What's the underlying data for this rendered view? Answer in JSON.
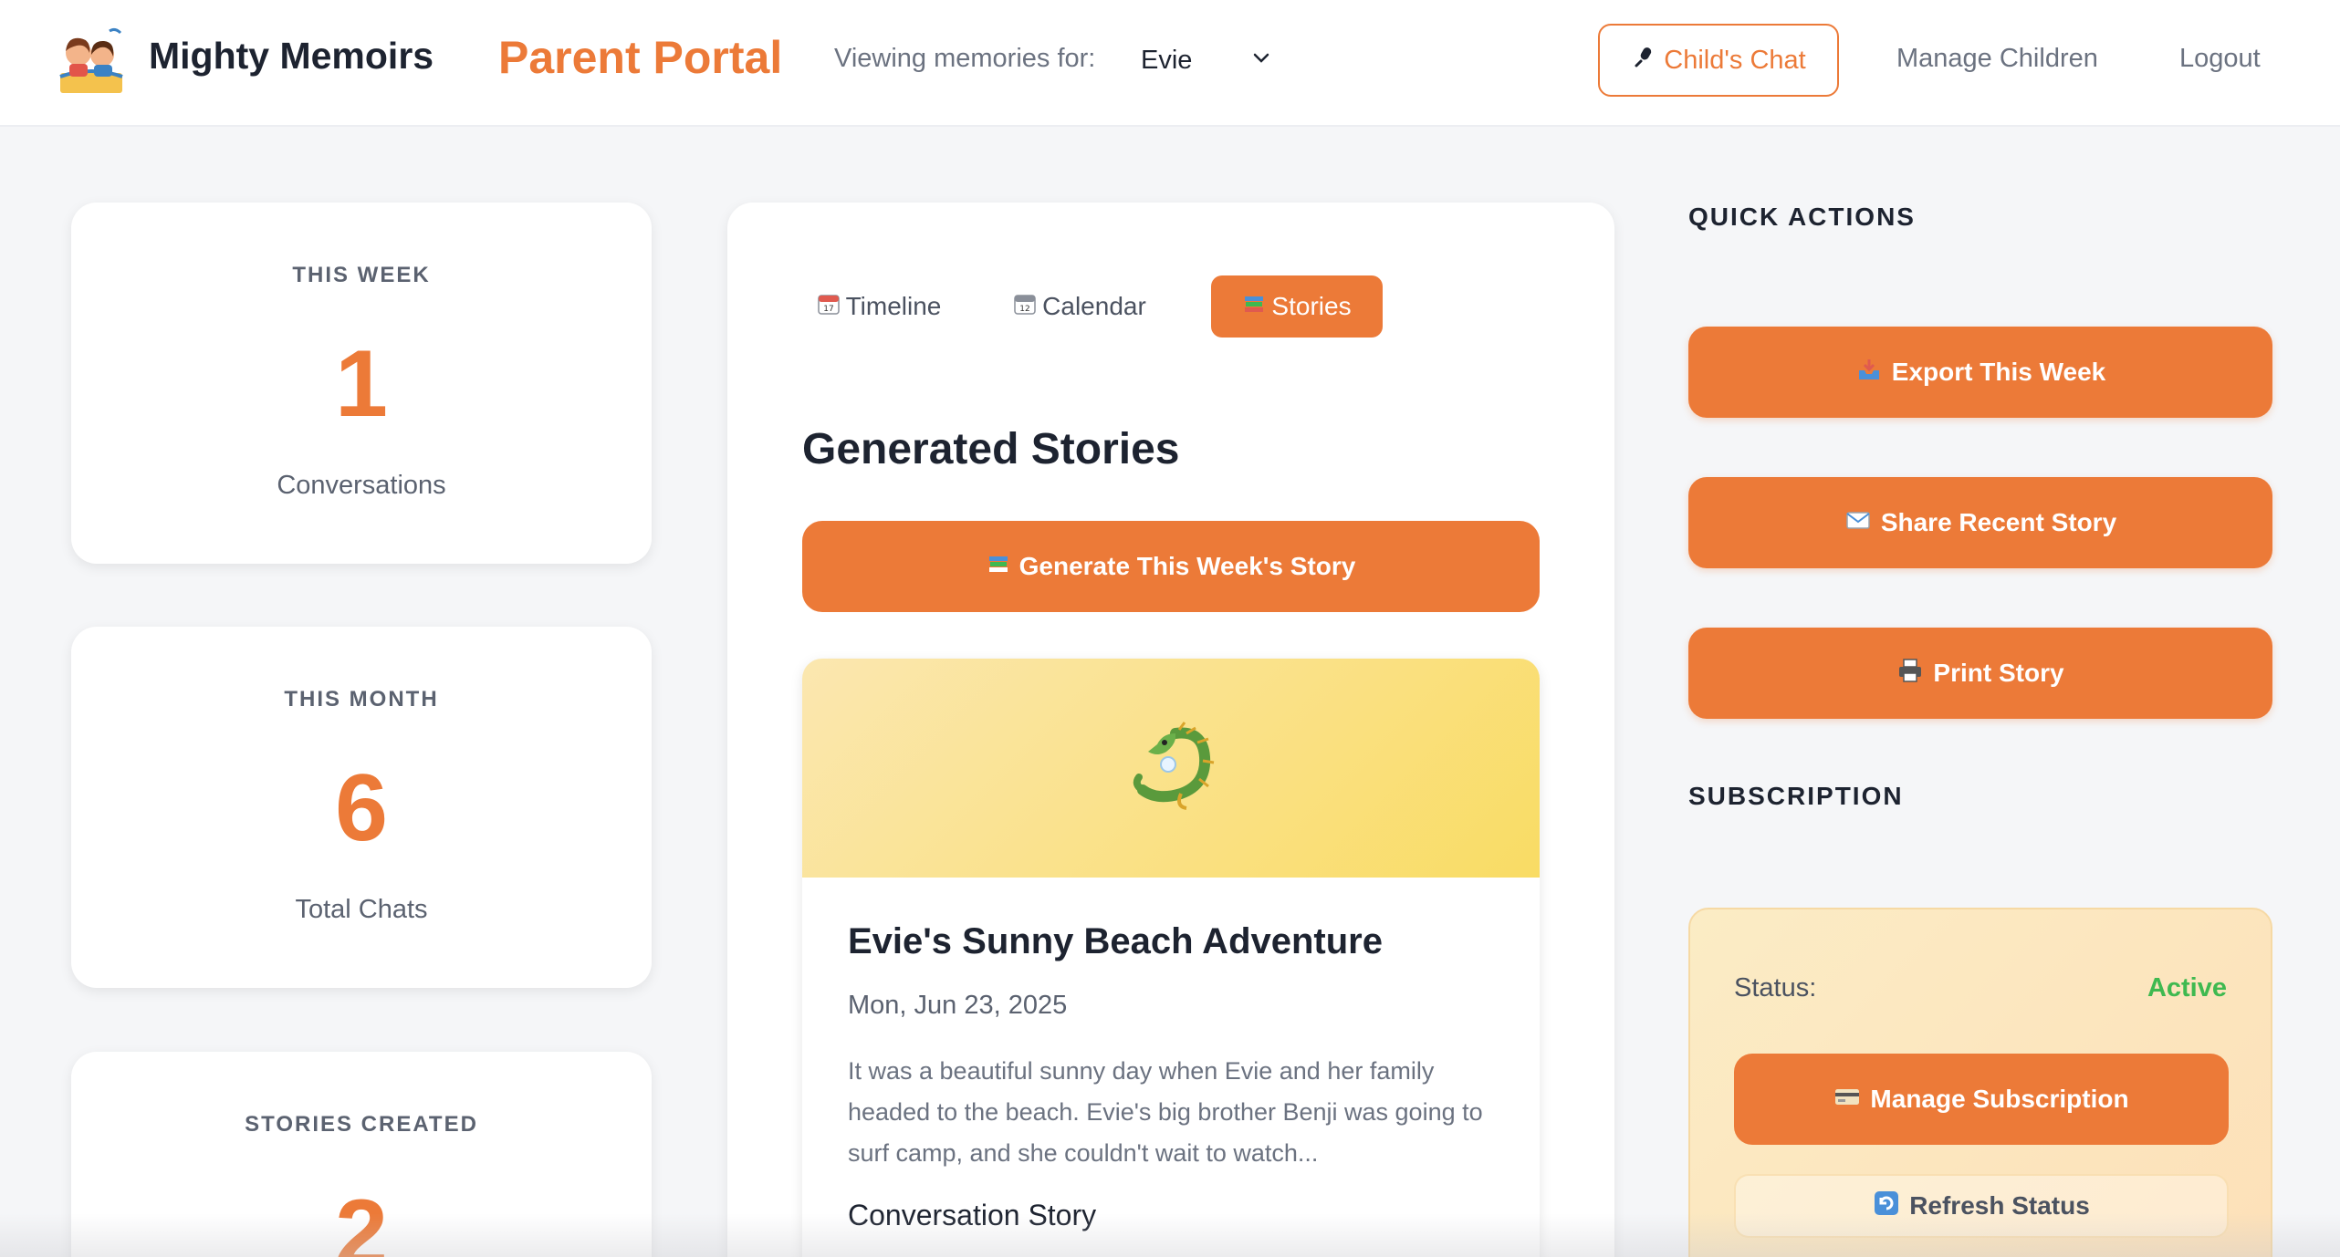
{
  "header": {
    "brand": "Mighty Memoirs",
    "portal_title": "Parent Portal",
    "viewing_label": "Viewing memories for:",
    "selected_child": "Evie",
    "childs_chat_label": "Child's Chat",
    "manage_children_label": "Manage Children",
    "logout_label": "Logout"
  },
  "stats": [
    {
      "label": "THIS WEEK",
      "value": "1",
      "caption": "Conversations"
    },
    {
      "label": "THIS MONTH",
      "value": "6",
      "caption": "Total Chats"
    },
    {
      "label": "STORIES CREATED",
      "value": "2",
      "caption": ""
    }
  ],
  "tabs": [
    {
      "label": "Timeline",
      "icon": "calendar-icon",
      "active": false
    },
    {
      "label": "Calendar",
      "icon": "calendar-icon",
      "active": false
    },
    {
      "label": "Stories",
      "icon": "books-icon",
      "active": true
    }
  ],
  "stories_section": {
    "title": "Generated Stories",
    "generate_button": "Generate This Week's Story",
    "story": {
      "banner_icon": "dragon-icon",
      "title": "Evie's Sunny Beach Adventure",
      "date": "Mon, Jun 23, 2025",
      "excerpt": "It was a beautiful sunny day when Evie and her family headed to the beach. Evie's big brother Benji was going to surf camp, and she couldn't wait to watch...",
      "type": "Conversation Story"
    }
  },
  "quick_actions": {
    "heading": "QUICK ACTIONS",
    "export_label": "Export This Week",
    "share_label": "Share Recent Story",
    "print_label": "Print Story"
  },
  "subscription": {
    "heading": "SUBSCRIPTION",
    "status_label": "Status:",
    "status_value": "Active",
    "manage_label": "Manage Subscription",
    "refresh_label": "Refresh Status"
  },
  "colors": {
    "accent": "#ec7a38",
    "active_status": "#3fb950"
  }
}
